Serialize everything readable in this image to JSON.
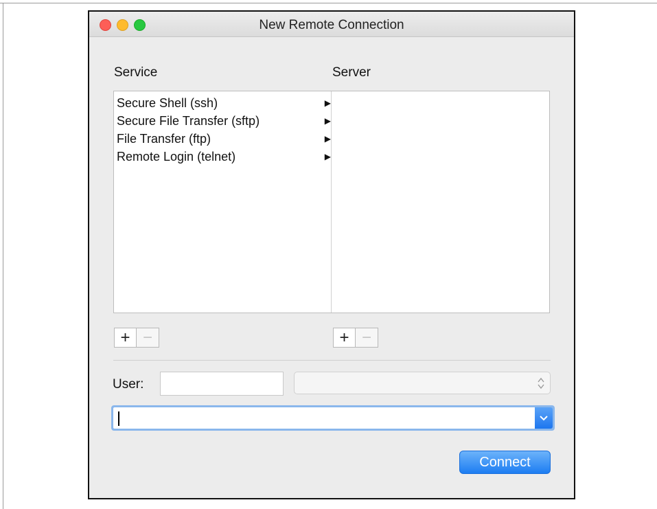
{
  "window": {
    "title": "New Remote Connection"
  },
  "service": {
    "label": "Service",
    "items": [
      {
        "label": "Secure Shell (ssh)"
      },
      {
        "label": "Secure File Transfer (sftp)"
      },
      {
        "label": "File Transfer (ftp)"
      },
      {
        "label": "Remote Login (telnet)"
      }
    ],
    "add_label": "+",
    "remove_label": "−"
  },
  "server": {
    "label": "Server",
    "items": [],
    "add_label": "+",
    "remove_label": "−"
  },
  "user": {
    "label": "User:",
    "value": ""
  },
  "host_select": {
    "selected": ""
  },
  "command": {
    "value": ""
  },
  "connect_label": "Connect",
  "icons": {
    "expand": "triangle-right-icon",
    "stepper": "up-down-chevron-icon",
    "dropdown": "chevron-down-icon"
  },
  "colors": {
    "accent": "#1d7df2",
    "focus_ring": "#8ab7ec"
  }
}
